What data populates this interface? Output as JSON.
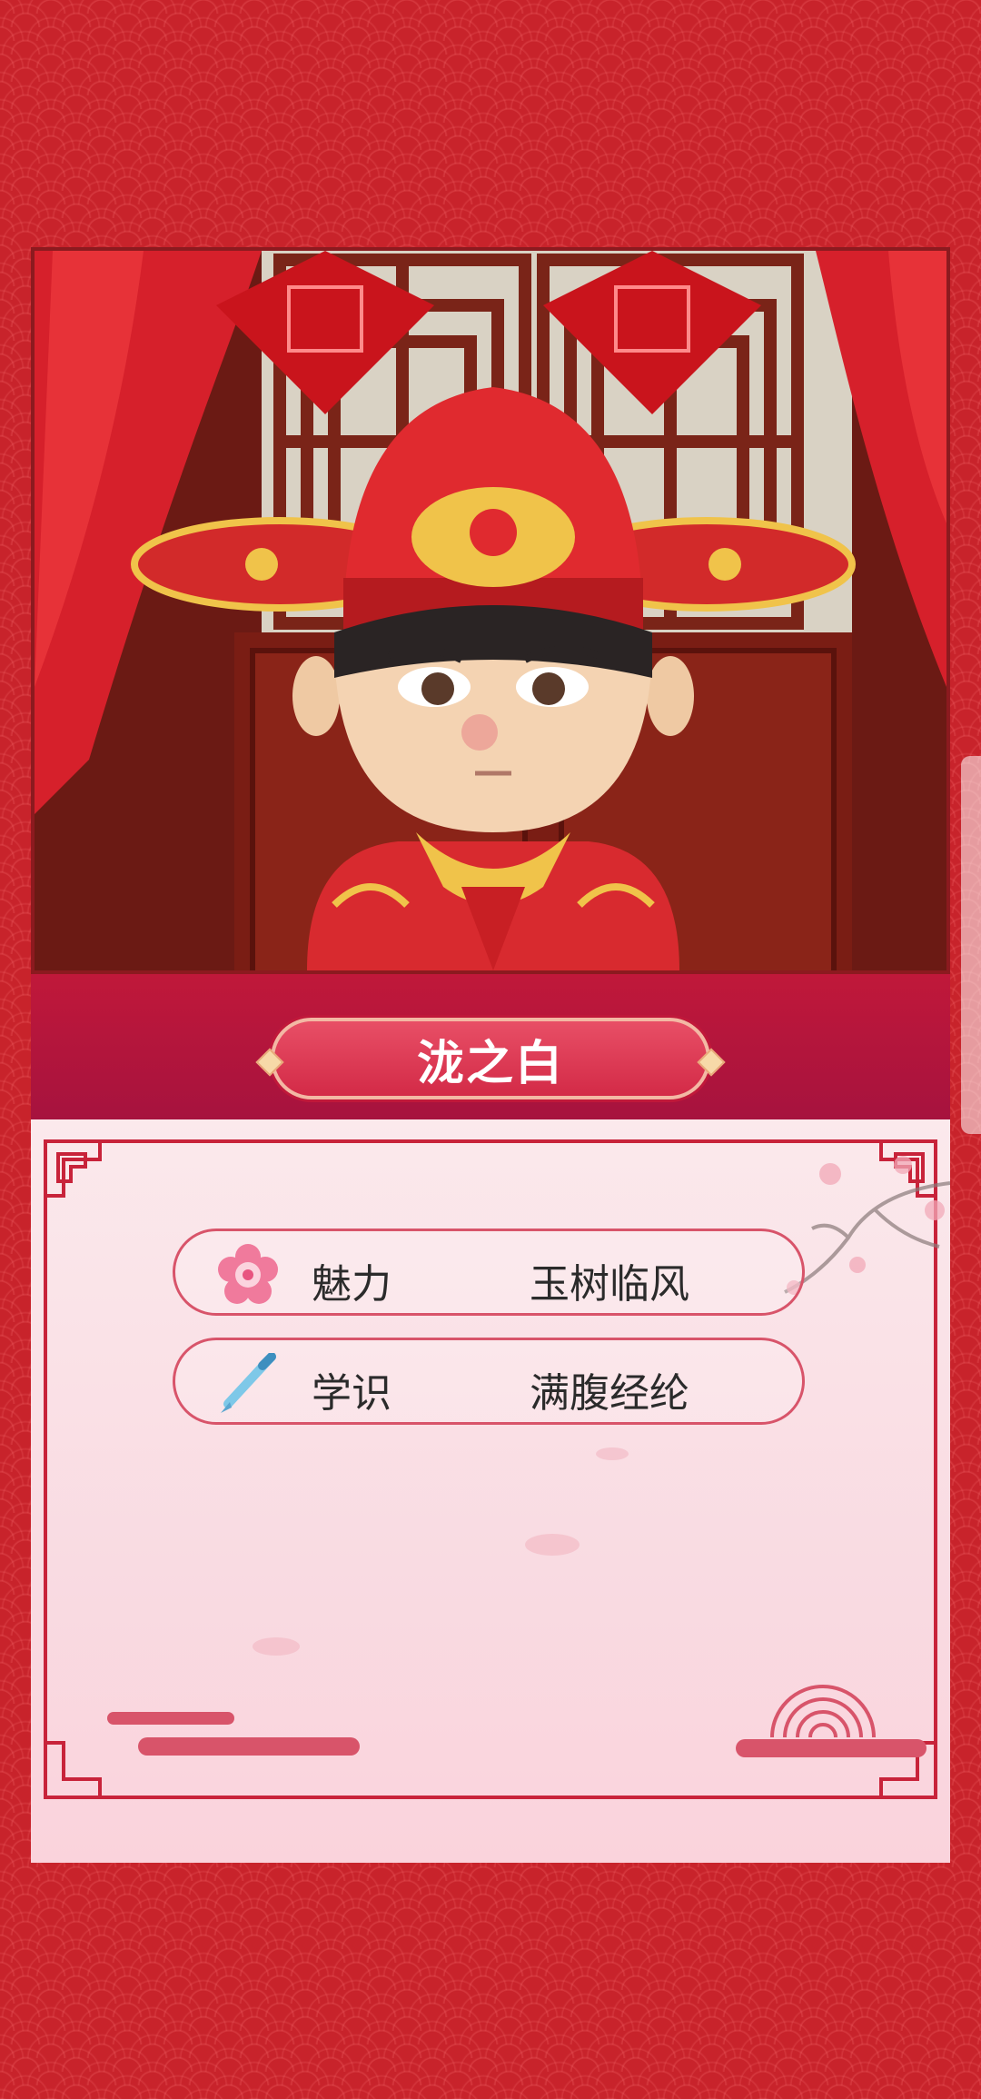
{
  "character": {
    "name": "泷之白"
  },
  "stats": [
    {
      "icon": "plum-blossom-icon",
      "label": "魅力",
      "value": "玉树临风"
    },
    {
      "icon": "writing-brush-icon",
      "label": "学识",
      "value": "满腹经纶"
    }
  ],
  "colors": {
    "background": "#c8232b",
    "nameBar": "#9a1040",
    "namePill": "#d32a47",
    "panel": "#fbe9ec",
    "border": "#d8546a"
  }
}
